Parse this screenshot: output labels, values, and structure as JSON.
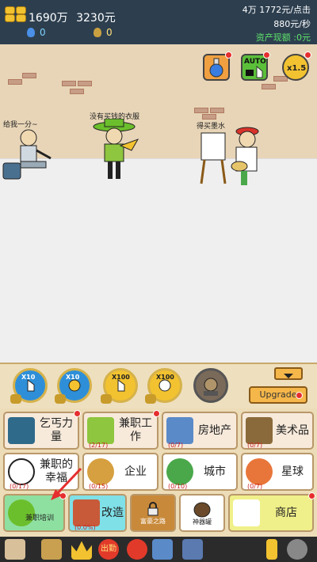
{
  "topbar": {
    "money": "1690万",
    "money2": "3230元",
    "potions": "0",
    "bags": "0",
    "per_click": "4万 1772元/点击",
    "per_second": "880元/秒",
    "asset_label": "资产现额 :0元"
  },
  "scene": {
    "beggar_label": "给我一分~",
    "man_label": "没有买钱的衣服",
    "painter_label": "得买墨水",
    "auto_label": "AUTO",
    "multiplier": "x1.5"
  },
  "skills": [
    {
      "badge": "X10"
    },
    {
      "badge": "X10"
    },
    {
      "badge": "X100"
    },
    {
      "badge": "X100"
    }
  ],
  "upgrade_label": "Upgrade",
  "cards": {
    "beg": {
      "label": "乞丐力量"
    },
    "parttime": {
      "label": "兼职工作",
      "count": "(2/17)"
    },
    "realestate": {
      "label": "房地产",
      "count": "(0/7)"
    },
    "art": {
      "label": "美术品",
      "count": "(0/7)"
    },
    "happiness": {
      "label": "兼职的幸福",
      "count": "(0/17)"
    },
    "enterprise": {
      "label": "企业",
      "count": "(0/15)"
    },
    "city": {
      "label": "城市",
      "count": "(0/10)"
    },
    "planet": {
      "label": "星球",
      "count": "(0/7)"
    },
    "training": {
      "label": "兼职培训"
    },
    "renovate": {
      "label": "改造",
      "count": "(0.0%)"
    },
    "rich_road": {
      "label": "富豪之路"
    },
    "magic_jar": {
      "label": "神器罐"
    },
    "shop": {
      "label": "商店"
    }
  },
  "bottom": {
    "event_label": "出勤"
  }
}
